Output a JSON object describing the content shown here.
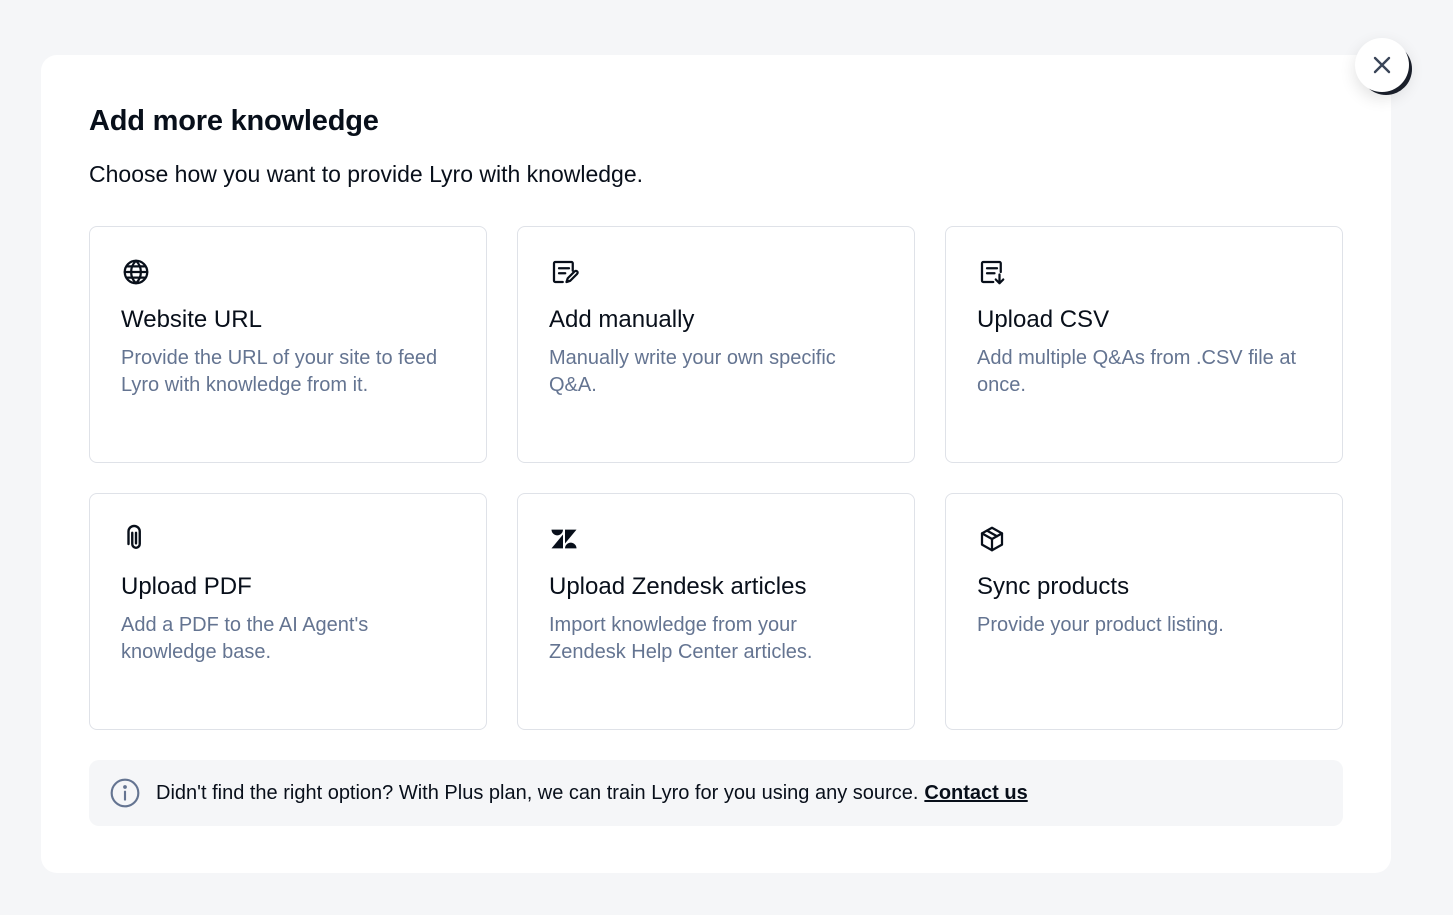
{
  "modal": {
    "title": "Add more knowledge",
    "subtitle": "Choose how you want to provide Lyro with knowledge."
  },
  "options": [
    {
      "icon": "globe-icon",
      "title": "Website URL",
      "description": "Provide the URL of your site to feed Lyro with knowledge from it."
    },
    {
      "icon": "edit-note-icon",
      "title": "Add manually",
      "description": "Manually write your own specific Q&A."
    },
    {
      "icon": "file-download-icon",
      "title": "Upload CSV",
      "description": "Add multiple Q&As from .CSV file at once."
    },
    {
      "icon": "paperclip-icon",
      "title": "Upload PDF",
      "description": "Add a PDF to the AI Agent's knowledge base."
    },
    {
      "icon": "zendesk-icon",
      "title": "Upload Zendesk articles",
      "description": "Import knowledge from your Zendesk Help Center articles."
    },
    {
      "icon": "package-icon",
      "title": "Sync products",
      "description": "Provide your product listing."
    }
  ],
  "info": {
    "icon": "info-icon",
    "text": "Didn't find the right option? With Plus plan, we can train Lyro for you using any source.",
    "link_label": "Contact us"
  },
  "close": {
    "icon": "close-icon"
  },
  "colors": {
    "background": "#f5f6f8",
    "text": "#080f1a",
    "muted_text": "#647491",
    "card_border": "#dfe2e8"
  }
}
